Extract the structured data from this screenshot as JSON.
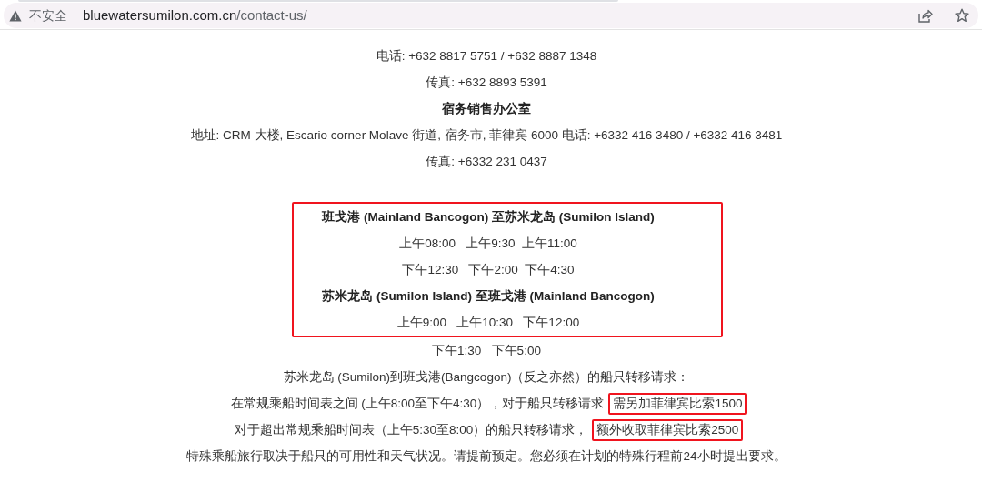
{
  "browser": {
    "security_label": "不安全",
    "url_host": "bluewatersumilon.com.cn",
    "url_path": "/contact-us/"
  },
  "contact_lines": [
    {
      "text": "电话: +632 8817 5751 / +632 8887 1348",
      "bold": false
    },
    {
      "text": "传真: +632 8893 5391",
      "bold": false
    },
    {
      "text": "宿务销售办公室",
      "bold": true
    },
    {
      "text": "地址: CRM 大楼, Escario corner Molave 街道, 宿务市, 菲律宾 6000 电话: +6332 416 3480 / +6332 416 3481",
      "bold": false
    },
    {
      "text": "传真: +6332 231 0437",
      "bold": false
    }
  ],
  "schedule_box": {
    "highlighted": true,
    "lines": [
      {
        "text": "班戈港 (Mainland Bancogon) 至苏米龙岛 (Sumilon Island)",
        "bold": true
      },
      {
        "text": "上午08:00   上午9:30  上午11:00",
        "bold": false
      },
      {
        "text": "下午12:30   下午2:00  下午4:30",
        "bold": false
      },
      {
        "text": "苏米龙岛 (Sumilon Island) 至班戈港 (Mainland Bancogon)",
        "bold": true
      },
      {
        "text": "上午9:00   上午10:30   下午12:00",
        "bold": false
      }
    ]
  },
  "after_lines": [
    {
      "text": "下午1:30   下午5:00",
      "bold": false
    }
  ],
  "transfer_lines": [
    {
      "segments": [
        {
          "text": "苏米龙岛 (Sumilon)到班戈港(Bangcogon)（反之亦然）的船只转移请求：",
          "highlighted": false
        }
      ]
    },
    {
      "segments": [
        {
          "text": "在常规乘船时间表之间 (上午8:00至下午4:30），对于船只转移请求",
          "highlighted": false
        },
        {
          "text": "需另加菲律宾比索1500",
          "highlighted": true
        }
      ]
    },
    {
      "segments": [
        {
          "text": "对于超出常规乘船时间表（上午5:30至8:00）的船只转移请求，",
          "highlighted": false
        },
        {
          "text": "额外收取菲律宾比索2500",
          "highlighted": true
        }
      ]
    },
    {
      "segments": [
        {
          "text": "特殊乘船旅行取决于船只的可用性和天气状况。请提前预定。您必须在计划的特殊行程前24小时提出要求。",
          "highlighted": false
        }
      ]
    }
  ]
}
